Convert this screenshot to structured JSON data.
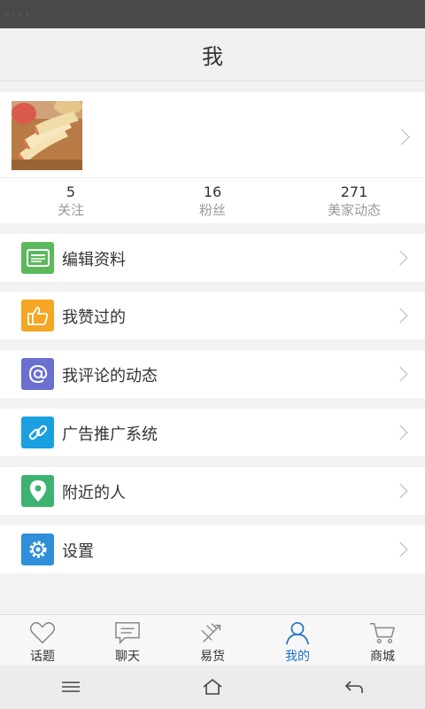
{
  "status_bar": {
    "dots": "· · · ·"
  },
  "header": {
    "title": "我"
  },
  "profile": {
    "avatar_icon": "apple-slices-photo"
  },
  "stats": [
    {
      "value": "5",
      "label": "关注"
    },
    {
      "value": "16",
      "label": "粉丝"
    },
    {
      "value": "271",
      "label": "美家动态"
    }
  ],
  "menu": [
    {
      "label": "编辑资料",
      "icon": "edit-profile-icon",
      "color": "#5cb85c"
    },
    {
      "label": "我赞过的",
      "icon": "thumbs-up-icon",
      "color": "#f5a623"
    },
    {
      "label": "我评论的动态",
      "icon": "at-sign-icon",
      "color": "#6a6fd0"
    },
    {
      "label": "广告推广系统",
      "icon": "link-icon",
      "color": "#1a9fe0"
    },
    {
      "label": "附近的人",
      "icon": "location-pin-icon",
      "color": "#3cb371"
    },
    {
      "label": "设置",
      "icon": "gear-icon",
      "color": "#2f8fd8"
    }
  ],
  "tabs": [
    {
      "label": "话题",
      "icon": "heart-icon",
      "active": false
    },
    {
      "label": "聊天",
      "icon": "chat-bubble-icon",
      "active": false
    },
    {
      "label": "易货",
      "icon": "exchange-arrows-icon",
      "active": false
    },
    {
      "label": "我的",
      "icon": "person-icon",
      "active": true
    },
    {
      "label": "商城",
      "icon": "cart-icon",
      "active": false
    }
  ],
  "colors": {
    "active_tab": "#1e72c9",
    "inactive_tab": "#333333"
  }
}
